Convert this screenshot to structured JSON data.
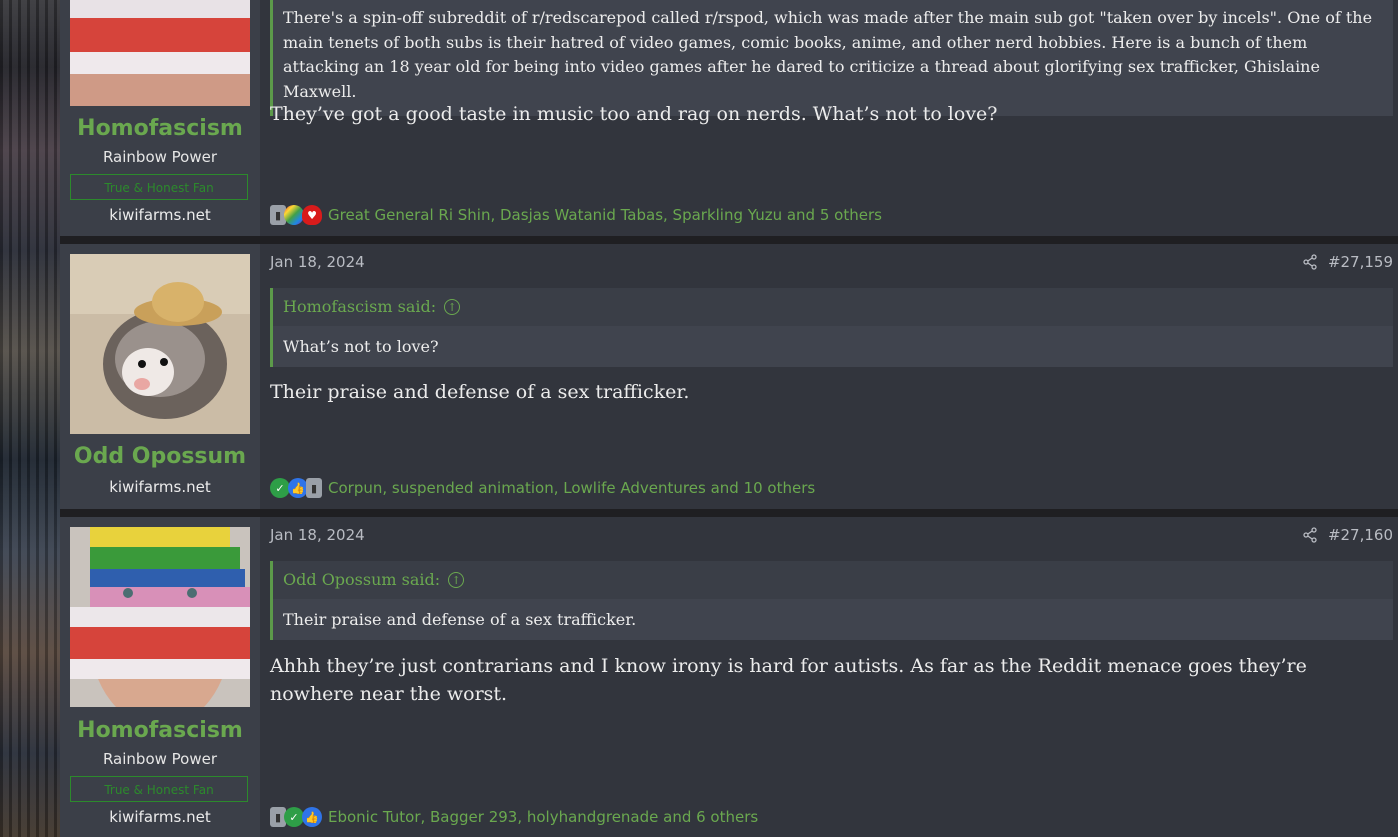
{
  "posts": [
    {
      "username": "Homofascism",
      "user_title": "Rainbow Power",
      "user_banner": "True & Honest Fan",
      "user_site": "kiwifarms.net",
      "quote_text": "There's a spin-off subreddit of r/redscarepod called r/rspod, which was made after the main sub got \"taken over by incels\". One of the main tenets of both subs is their hatred of video games, comic books, anime, and other nerd hobbies. Here is a bunch of them attacking an 18 year old for being into video games after he dared to criticize a thread about glorifying sex trafficker, Ghislaine Maxwell.",
      "message": "They’ve got a good taste in music too and rag on nerds. What’s not to love?",
      "reactions": [
        "gray-block",
        "rainbow",
        "heart"
      ],
      "reaction_names": "Great General Ri Shin, Dasjas Watanid Tabas, Sparkling Yuzu and 5 others"
    },
    {
      "username": "Odd Opossum",
      "user_site": "kiwifarms.net",
      "date": "Jan 18, 2024",
      "post_number": "#27,159",
      "quote_author": "Homofascism said:",
      "quote_text": "What’s not to love?",
      "message": "Their praise and defense of a sex trafficker.",
      "reactions": [
        "check",
        "like",
        "gray-block"
      ],
      "reaction_names": "Corpun, suspended animation, Lowlife Adventures and 10 others"
    },
    {
      "username": "Homofascism",
      "user_title": "Rainbow Power",
      "user_banner": "True & Honest Fan",
      "user_site": "kiwifarms.net",
      "date": "Jan 18, 2024",
      "post_number": "#27,160",
      "quote_author": "Odd Opossum said:",
      "quote_text": "Their praise and defense of a sex trafficker.",
      "message": "Ahhh they’re just contrarians and I know irony is hard for autists. As far as the Reddit menace goes they’re nowhere near the worst.",
      "reactions": [
        "gray-block",
        "check",
        "like"
      ],
      "reaction_names": "Ebonic Tutor, Bagger 293, holyhandgrenade and 6 others"
    }
  ],
  "colors": {
    "accent_green": "#6aa84f",
    "banner_green": "#2c8a2c",
    "post_bg": "#32353d",
    "user_bg": "#3b3f48"
  },
  "icons": {
    "share": "share-icon",
    "quote_jump": "arrow-up-circle-icon"
  }
}
